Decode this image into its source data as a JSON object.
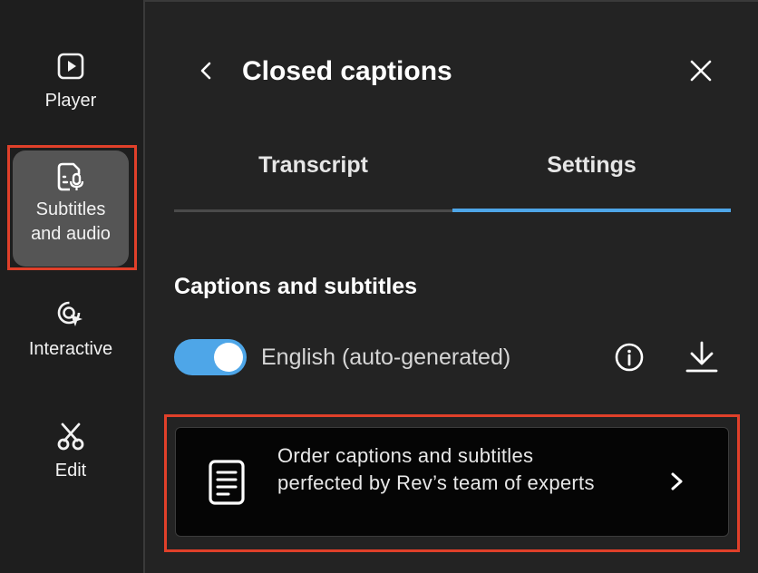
{
  "sidebar": {
    "items": [
      {
        "label": "Player",
        "icon": "play-icon"
      },
      {
        "label": "Subtitles\nand audio",
        "icon": "subtitles-mic-icon",
        "active": true
      },
      {
        "label": "Interactive",
        "icon": "interactive-cursor-icon"
      },
      {
        "label": "Edit",
        "icon": "scissors-icon"
      }
    ]
  },
  "header": {
    "title": "Closed captions"
  },
  "tabs": [
    {
      "label": "Transcript",
      "active": false
    },
    {
      "label": "Settings",
      "active": true
    }
  ],
  "settings": {
    "section_title": "Captions and subtitles",
    "captions_toggle_on": true,
    "language_label": "English (auto-generated)"
  },
  "order_card": {
    "text": "Order captions and subtitles perfected by Rev’s team of experts"
  },
  "colors": {
    "accent": "#4ea6e8",
    "highlight": "#e0402a",
    "background": "#232323",
    "sidebar_active": "#555555"
  }
}
